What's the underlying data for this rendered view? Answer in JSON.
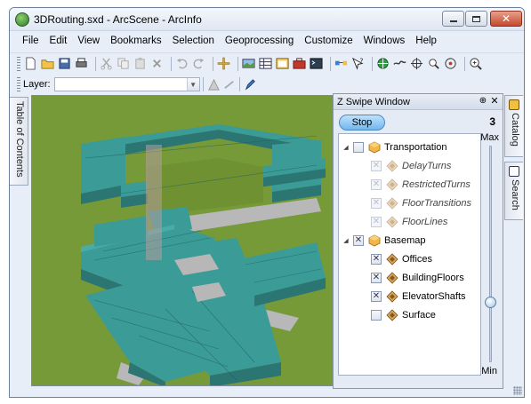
{
  "window": {
    "title": "3DRouting.sxd - ArcScene - ArcInfo",
    "close_symbol": "✕"
  },
  "menu": [
    "File",
    "Edit",
    "View",
    "Bookmarks",
    "Selection",
    "Geoprocessing",
    "Customize",
    "Windows",
    "Help"
  ],
  "toolbar": {
    "icons": [
      "new-document-icon",
      "open-folder-icon",
      "save-icon",
      "print-icon",
      "cut-icon",
      "copy-icon",
      "paste-icon",
      "delete-icon",
      "undo-icon",
      "redo-icon",
      "add-data-icon",
      "scene-properties-icon",
      "table-icon",
      "catalog-window-icon",
      "toolbox-icon",
      "python-icon",
      "model-builder-icon",
      "whats-this-icon",
      "navigate-icon",
      "fly-icon",
      "target-center-icon",
      "zoom-to-target-icon",
      "set-observer-icon",
      "zoom-in-out-icon"
    ]
  },
  "layer_bar": {
    "label": "Layer:",
    "value": ""
  },
  "left_tab": {
    "label": "Table of Contents"
  },
  "swipe_window": {
    "title": "Z Swipe Window",
    "pin_symbol": "⊕",
    "close_symbol": "✕",
    "stop_label": "Stop",
    "count": "3",
    "max_label": "Max",
    "min_label": "Min",
    "slider_fraction": 0.72,
    "groups": [
      {
        "name": "Transportation",
        "checked": false,
        "expanded": true,
        "layers": [
          {
            "name": "DelayTurns",
            "checked": true,
            "disabled": true,
            "italic": true
          },
          {
            "name": "RestrictedTurns",
            "checked": true,
            "disabled": true,
            "italic": true
          },
          {
            "name": "FloorTransitions",
            "checked": true,
            "disabled": true,
            "italic": true
          },
          {
            "name": "FloorLines",
            "checked": true,
            "disabled": true,
            "italic": true
          }
        ]
      },
      {
        "name": "Basemap",
        "checked": true,
        "expanded": true,
        "layers": [
          {
            "name": "Offices",
            "checked": true,
            "disabled": false,
            "italic": false
          },
          {
            "name": "BuildingFloors",
            "checked": true,
            "disabled": false,
            "italic": false
          },
          {
            "name": "ElevatorShafts",
            "checked": true,
            "disabled": false,
            "italic": false
          },
          {
            "name": "Surface",
            "checked": false,
            "disabled": false,
            "italic": false
          }
        ]
      }
    ]
  },
  "right_tabs": [
    {
      "label": "Catalog",
      "icon": "catalog-icon"
    },
    {
      "label": "Search",
      "icon": "search-icon"
    }
  ],
  "colors": {
    "grass": "#6e8f2e",
    "building": "#3a9b97",
    "building_shade": "#2b7573",
    "floor_gray": "#b7b7b7",
    "stop_button": "#70b7ee"
  }
}
